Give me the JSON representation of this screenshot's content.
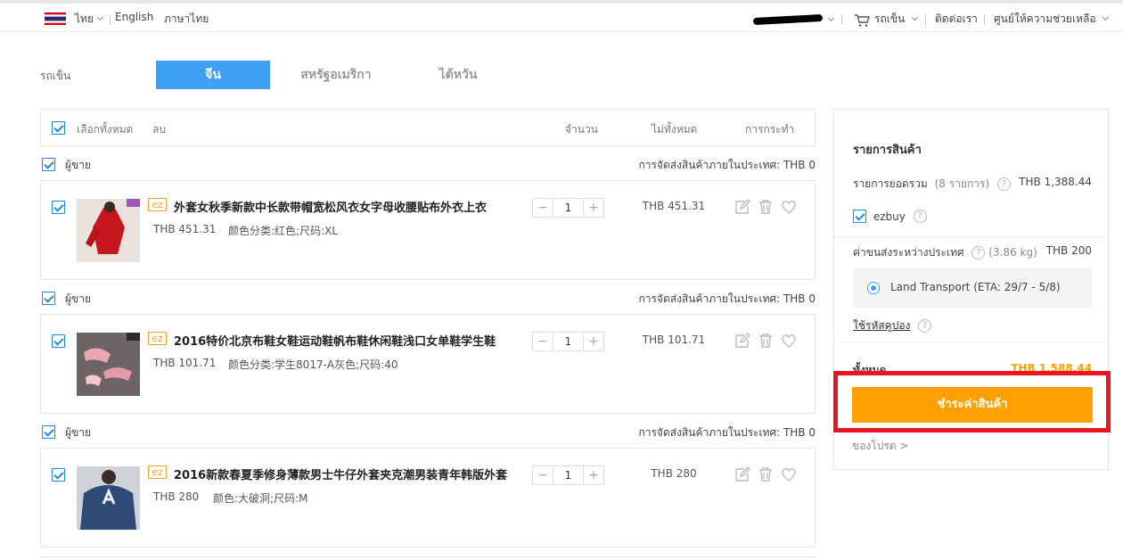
{
  "topbar": {
    "lang_current": "ไทย",
    "lang_english": "English",
    "lang_thai": "ภาษาไทย",
    "cart_label": "รถเข็น",
    "contact_label": "ติดต่อเรา",
    "help_label": "ศูนย์ให้ความช่วยเหลือ"
  },
  "tabs": {
    "section_label": "รถเข็น",
    "items": [
      {
        "label": "จีน"
      },
      {
        "label": "สหรัฐอเมริกา"
      },
      {
        "label": "ไต้หวัน"
      }
    ]
  },
  "table_header": {
    "select_all": "เลือกทั้งหมด",
    "delete": "ลบ",
    "quantity": "จำนวน",
    "subtotal": "ไม่ทั้งหมด",
    "action": "การกระทำ"
  },
  "sellers": [
    {
      "label": "ผู้ขาย",
      "shipping": "การจัดส่งสินค้าภายในประเทศ: THB 0",
      "item": {
        "badge": "ez",
        "title": "外套女秋季新款中长款带帽宽松风衣女字母收腰贴布外衣上衣",
        "price": "THB 451.31",
        "variant": "颜色分类:红色;尺码:XL",
        "qty": "1",
        "subtotal": "THB 451.31"
      }
    },
    {
      "label": "ผู้ขาย",
      "shipping": "การจัดส่งสินค้าภายในประเทศ: THB 0",
      "item": {
        "badge": "ez",
        "title": "2016特价北京布鞋女鞋运动鞋帆布鞋休闲鞋浅口女单鞋学生鞋",
        "price": "THB 101.71",
        "variant": "颜色分类:学生8017-A灰色;尺码:40",
        "qty": "1",
        "subtotal": "THB 101.71"
      }
    },
    {
      "label": "ผู้ขาย",
      "shipping": "การจัดส่งสินค้าภายในประเทศ: THB 0",
      "item": {
        "badge": "ez",
        "title": "2016新款春夏季修身薄款男士牛仔外套夹克潮男装青年韩版外套",
        "price": "THB 280",
        "variant": "颜色:大破洞;尺码:M",
        "qty": "1",
        "subtotal": "THB 280"
      }
    }
  ],
  "stepper": {
    "minus": "−",
    "plus": "+"
  },
  "summary": {
    "title": "รายการสินค้า",
    "total_label": "รายการยอดรวม",
    "total_count": "(8 รายการ)",
    "total_value": "THB 1,388.44",
    "ezbuy": "ezbuy",
    "intl_ship_label": "ค่าขนส่งระหว่างประเทศ",
    "intl_ship_weight": "(3.86 kg)",
    "intl_ship_value": "THB 200",
    "transport": "Land Transport (ETA: 29/7 - 5/8)",
    "coupon": "ใช้รหัสคูปอง",
    "grand_label": "ทั้งหมด",
    "grand_value": "THB 1,588.44",
    "pay_button": "ชำระค่าสินค้า",
    "gift": "ของโปรด >"
  },
  "colors": {
    "accent_blue": "#3fa1f3",
    "pay_orange": "#ff9f00",
    "highlight_red": "#e8151e"
  }
}
